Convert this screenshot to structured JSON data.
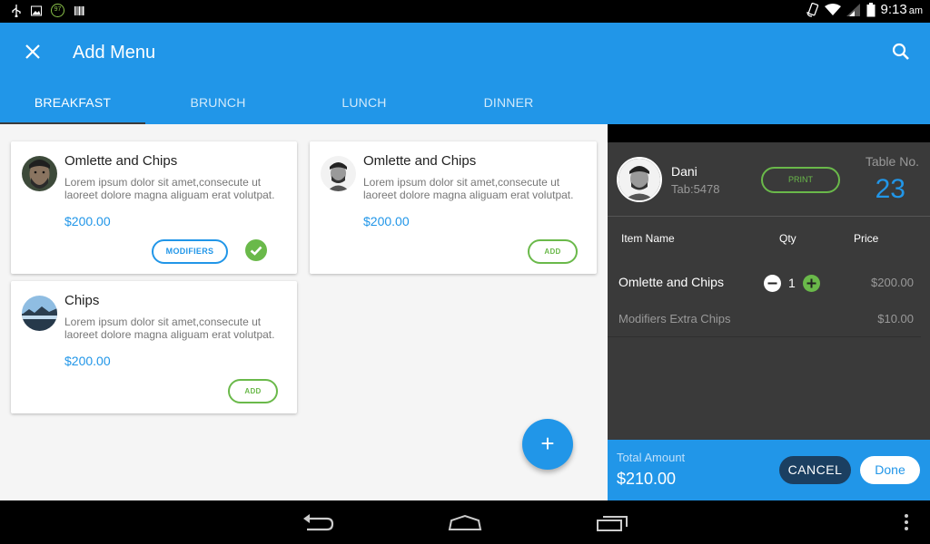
{
  "status_bar": {
    "battery_level": "97",
    "time": "9:13",
    "ampm": "am",
    "icons": [
      "usb-icon",
      "image-icon",
      "battery-badge-icon",
      "barcode-icon",
      "rotate-icon",
      "wifi-icon",
      "signal-icon",
      "battery-icon"
    ]
  },
  "app_bar": {
    "title": "Add Menu",
    "close_icon": "close-icon",
    "search_icon": "search-icon"
  },
  "tabs": [
    {
      "label": "BREAKFAST",
      "active": true
    },
    {
      "label": "BRUNCH",
      "active": false
    },
    {
      "label": "LUNCH",
      "active": false
    },
    {
      "label": "DINNER",
      "active": false
    }
  ],
  "menu_items": [
    {
      "title": "Omlette and Chips",
      "description": "Lorem ipsum dolor sit amet,consecute ut laoreet dolore magna aliguam erat volutpat.",
      "price": "$200.00",
      "modifiers_label": "MODIFIERS",
      "selected": true
    },
    {
      "title": "Omlette and Chips",
      "description": "Lorem ipsum dolor sit amet,consecute ut laoreet dolore magna aliguam erat volutpat.",
      "price": "$200.00",
      "add_label": "ADD"
    },
    {
      "title": "Chips",
      "description": "Lorem ipsum dolor sit amet,consecute ut laoreet dolore magna aliguam erat volutpat.",
      "price": "$200.00",
      "add_label": "ADD"
    }
  ],
  "fab": {
    "label": "+"
  },
  "order": {
    "customer_name": "Dani",
    "tab": "Tab:5478",
    "print_label": "PRINT",
    "table_label": "Table No.",
    "table_number": "23",
    "columns": {
      "item": "Item Name",
      "qty": "Qty",
      "price": "Price"
    },
    "items": [
      {
        "name": "Omlette and Chips",
        "qty": "1",
        "price": "$200.00",
        "modifier_name": "Modifiers Extra Chips",
        "modifier_price": "$10.00"
      }
    ],
    "total_label": "Total Amount",
    "total_amount": "$210.00",
    "cancel_label": "CANCEL",
    "done_label": "Done"
  },
  "colors": {
    "primary": "#2196e8",
    "success": "#6ab94a",
    "panel": "#3a3a3a",
    "cancel": "#1b3f61"
  }
}
